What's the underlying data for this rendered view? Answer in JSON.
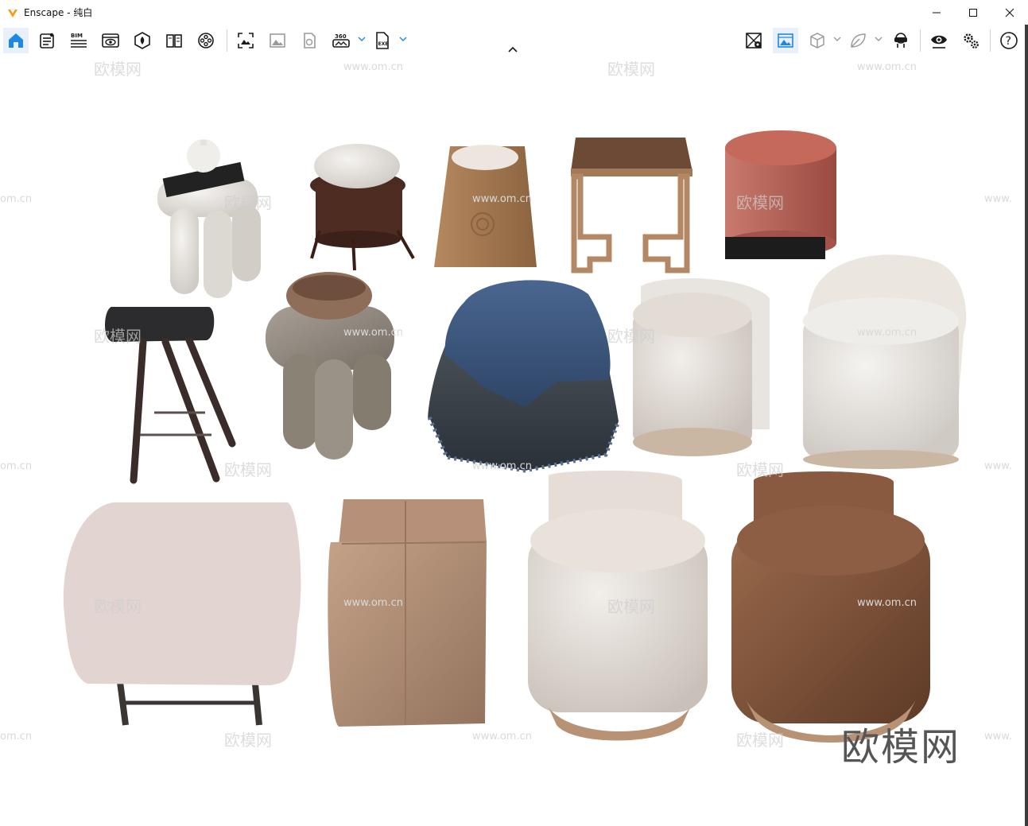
{
  "window": {
    "app_name": "Enscape",
    "title": "Enscape - 纯白",
    "controls": {
      "minimize": "—",
      "maximize": "☐",
      "close": "✕"
    }
  },
  "toolbar": {
    "left_icons": [
      "home-icon",
      "asset-library-icon",
      "bim-icon",
      "view-management-icon",
      "material-editor-icon",
      "book-icon",
      "video-reel-icon",
      "screenshot-icon",
      "image-icon",
      "panorama-icon",
      "360-icon",
      "exe-export-icon"
    ],
    "bim_label": "BIM",
    "pano_label": "360",
    "exe_label": "EXE",
    "right_icons": [
      "visual-settings-icon",
      "batch-render-icon",
      "cube-view-icon",
      "leaf-icon",
      "vr-headset-icon",
      "eye-icon",
      "settings-gears-icon",
      "help-icon"
    ],
    "help_label": "?"
  },
  "viewport": {
    "watermark_text": "欧模网",
    "watermark_url": "www.om.cn",
    "watermark_edge": "om.cn",
    "watermark_edge_right": "www.",
    "brand_mark": "欧模网",
    "objects": [
      "stool-white-stone-with-vase",
      "stool-white-cushion-dark-frame",
      "stool-wood-trapezoid",
      "side-table-wood-frame",
      "pouf-red-velvet",
      "bar-stool-black-top",
      "stool-stone-with-bowl",
      "side-table-blue-tablecloth",
      "armchair-pouf-white-fabric",
      "armchair-pouf-white-tall-back",
      "ottoman-pink-fabric",
      "pouf-tan-leather-square",
      "armchair-pouf-cream-leather",
      "armchair-pouf-brown-leather"
    ]
  },
  "colors": {
    "active_tool": "#e8f1fb",
    "icon_dark": "#1a1a1a",
    "icon_blue": "#1e88e5",
    "brand_orange": "#f39c12"
  }
}
